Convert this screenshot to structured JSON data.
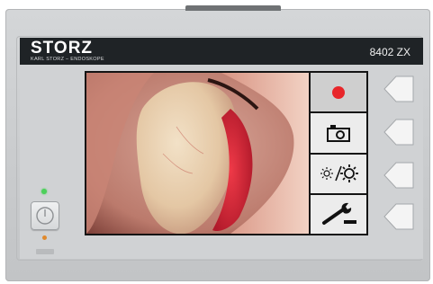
{
  "device": {
    "brand": "STORZ",
    "brand_subtitle": "KARL STORZ – ENDOSKOPE",
    "model": "8402 ZX"
  },
  "menu": {
    "items": [
      {
        "name": "record",
        "icon": "record-icon"
      },
      {
        "name": "snapshot",
        "icon": "camera-icon"
      },
      {
        "name": "brightness",
        "icon": "brightness-icon"
      },
      {
        "name": "settings",
        "icon": "wrench-icon"
      }
    ]
  },
  "side_buttons": {
    "icon": "arrow-left-icon",
    "count": 4
  },
  "indicators": {
    "top_led_color": "#4cd05a",
    "bottom_led_color": "#e0892d",
    "record_color": "#e8262a"
  }
}
